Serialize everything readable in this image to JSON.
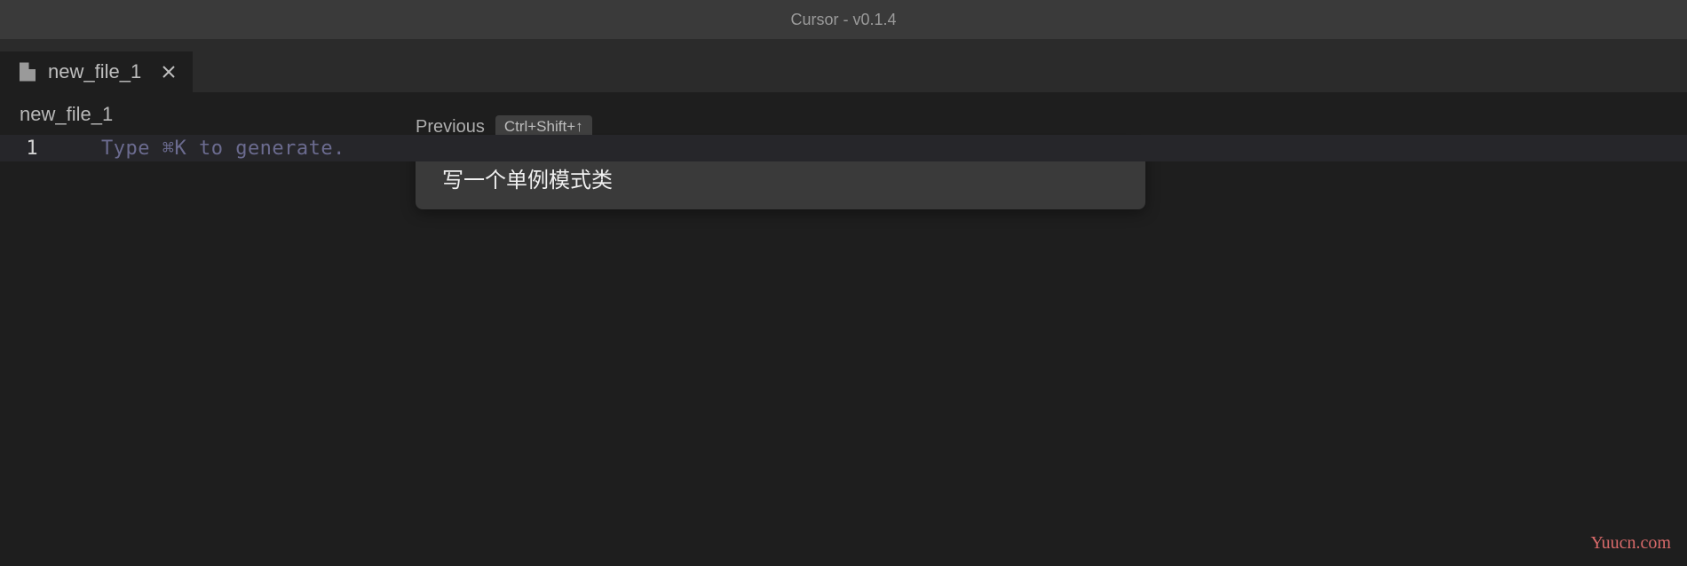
{
  "titlebar": {
    "title": "Cursor - v0.1.4"
  },
  "tabs": [
    {
      "label": "new_file_1"
    }
  ],
  "breadcrumb": {
    "filename": "new_file_1"
  },
  "previous": {
    "label": "Previous",
    "shortcut": "Ctrl+Shift+↑"
  },
  "editor": {
    "lines": [
      {
        "number": "1",
        "placeholder": "Type ⌘K to generate."
      }
    ]
  },
  "prompt": {
    "text": "写一个单例模式类"
  },
  "watermark": "Yuucn.com"
}
